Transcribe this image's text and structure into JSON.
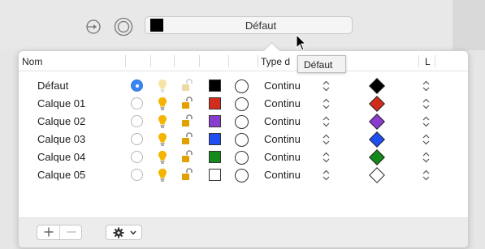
{
  "toolbar": {
    "current_layer": {
      "name": "Défaut",
      "color": "#000000"
    }
  },
  "tooltip": {
    "text": "Défaut"
  },
  "table": {
    "headers": {
      "name": "Nom",
      "type": "Type d",
      "last": "L"
    },
    "rows": [
      {
        "name": "Défaut",
        "active": true,
        "color": "#000000",
        "type": "Continu"
      },
      {
        "name": "Calque 01",
        "active": false,
        "color": "#d22d1c",
        "type": "Continu"
      },
      {
        "name": "Calque 02",
        "active": false,
        "color": "#8a3bd0",
        "type": "Continu"
      },
      {
        "name": "Calque 03",
        "active": false,
        "color": "#1f4ff2",
        "type": "Continu"
      },
      {
        "name": "Calque 04",
        "active": false,
        "color": "#138a19",
        "type": "Continu"
      },
      {
        "name": "Calque 05",
        "active": false,
        "color": "#ffffff",
        "type": "Continu"
      }
    ]
  },
  "footer": {
    "add_icon": "plus-icon",
    "remove_icon": "minus-icon",
    "actions_icon": "gear-icon"
  },
  "colors": {
    "accent": "#3a85f5",
    "bulb": "#f5b400",
    "lock": "#e0a000"
  }
}
